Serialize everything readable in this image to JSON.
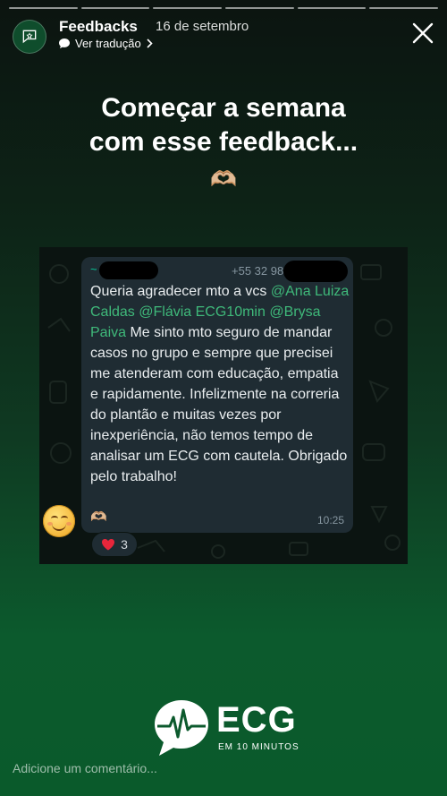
{
  "header": {
    "title": "Feedbacks",
    "date": "16 de setembro",
    "translate_label": "Ver tradução"
  },
  "story": {
    "headline_line1": "Começar a semana",
    "headline_line2": "com esse feedback...",
    "headline_emoji": "🫶🏼"
  },
  "message": {
    "sender": "~",
    "phone": "+55 32 98",
    "text_1": "Queria agradecer mto a vcs ",
    "mention_1": "@Ana Luiza Caldas",
    "mention_2": "@Flávia ECG10min",
    "mention_3": "@Brysa Paiva",
    "text_2": " Me sinto mto seguro de mandar casos no grupo e sempre que precisei me atenderam com educação, empatia e rapidamente. Infelizmente na correria do plantão e muitas vezes por inexperiência, não temos tempo de analisar um ECG com cautela. Obrigado pelo trabalho!",
    "emoji": "🫶🏼",
    "time": "10:25",
    "reaction_count": "3"
  },
  "logo": {
    "name": "ECG",
    "tagline": "EM 10 MINUTOS"
  },
  "footer": {
    "comment_placeholder": "Adicione um comentário..."
  }
}
